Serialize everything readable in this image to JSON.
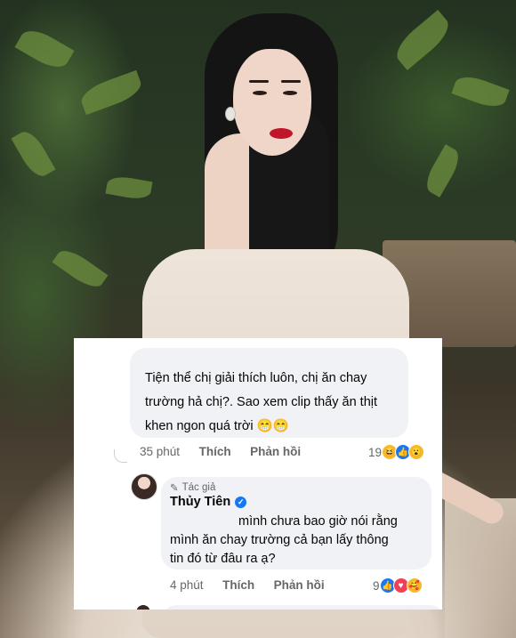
{
  "comment1": {
    "line1": "Tiện thể chị giải thích luôn, chị ăn chay",
    "line2": "trường hả chị?. Sao xem clip thấy ăn thịt",
    "line3": "khen ngon quá trời",
    "emoji": "😁😁",
    "time": "35 phút",
    "like_label": "Thích",
    "reply_label": "Phản hồi",
    "reaction_count": "19",
    "reactions": [
      "haha-icon",
      "like-icon",
      "wow-icon"
    ]
  },
  "reply": {
    "author_tag": "Tác giả",
    "author_name": "Thủy Tiên",
    "line1": "mình chưa bao giờ nói rằng",
    "line2": "mình ăn chay trường cả bạn lấy thông",
    "line3": "tin đó từ đâu ra ạ?",
    "time": "4 phút",
    "like_label": "Thích",
    "reply_label": "Phản hồi",
    "reaction_count": "9",
    "reactions": [
      "like-icon",
      "love-icon",
      "care-icon"
    ]
  },
  "colors": {
    "accent": "#1877f2",
    "bubble": "#f0f2f5",
    "lips": "#c0152a"
  }
}
